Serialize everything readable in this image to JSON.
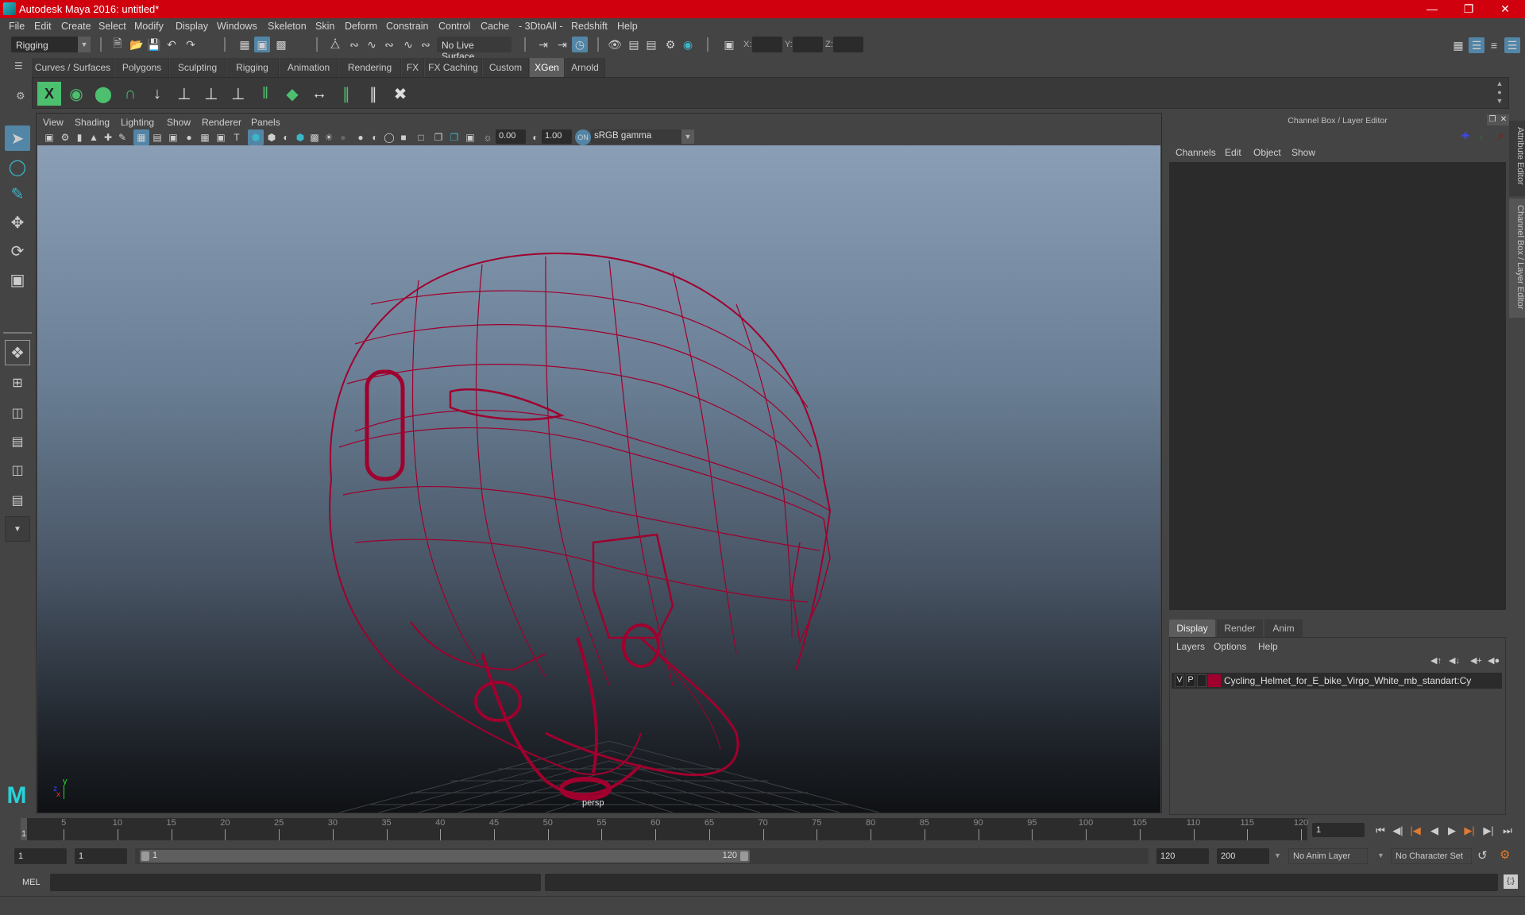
{
  "window": {
    "title": "Autodesk Maya 2016: untitled*",
    "controls": [
      "minimize",
      "restore",
      "close"
    ]
  },
  "menubar": [
    "File",
    "Edit",
    "Create",
    "Select",
    "Modify",
    "Display",
    "Windows",
    "Skeleton",
    "Skin",
    "Deform",
    "Constrain",
    "Control",
    "Cache",
    "- 3DtoAll -",
    "Redshift",
    "Help"
  ],
  "statusline": {
    "menuset": "Rigging",
    "live_surface": "No Live Surface",
    "x_label": "X:",
    "y_label": "Y:",
    "z_label": "Z:",
    "x_value": "",
    "y_value": "",
    "z_value": ""
  },
  "shelf": {
    "tabs": [
      "Curves / Surfaces",
      "Polygons",
      "Sculpting",
      "Rigging",
      "Animation",
      "Rendering",
      "FX",
      "FX Caching",
      "Custom",
      "XGen",
      "Arnold"
    ],
    "active_tab": "XGen",
    "icons": [
      "xgen-editor-icon",
      "xgen-preview-icon",
      "xgen-clear-icon",
      "add-guides-icon",
      "place-guides-icon",
      "add-guide-icon",
      "sculpt-guide-icon",
      "lock-guide-icon",
      "split-guide-icon",
      "region-map-icon",
      "rebuild-guide-icon",
      "select-guides-icon",
      "guide-width-icon",
      "delete-guide-icon"
    ]
  },
  "panel": {
    "menu": [
      "View",
      "Shading",
      "Lighting",
      "Show",
      "Renderer",
      "Panels"
    ],
    "exposure": "0.00",
    "gamma": "1.00",
    "color_space": "sRGB gamma",
    "camera_label": "persp",
    "axis": {
      "y": "y",
      "z": "z",
      "x": "x"
    },
    "wire_color": "#a0002e"
  },
  "channel_box": {
    "title": "Channel Box / Layer Editor",
    "menu": [
      "Channels",
      "Edit",
      "Object",
      "Show"
    ],
    "layer_tabs": [
      "Display",
      "Render",
      "Anim"
    ],
    "active_layer_tab": "Display",
    "layer_menu": [
      "Layers",
      "Options",
      "Help"
    ],
    "layers": [
      {
        "v": "V",
        "p": "P",
        "color": "#a0002e",
        "name": "Cycling_Helmet_for_E_bike_Virgo_White_mb_standart:Cy"
      }
    ]
  },
  "side_tabs": [
    "Attribute Editor",
    "Channel Box / Layer Editor"
  ],
  "timeline": {
    "ticks": [
      5,
      10,
      15,
      20,
      25,
      30,
      35,
      40,
      45,
      50,
      55,
      60,
      65,
      70,
      75,
      80,
      85,
      90,
      95,
      100,
      105,
      110,
      115,
      120
    ],
    "min": 1,
    "max": 120,
    "current_frame_marker": "1",
    "current_frame": "1"
  },
  "range": {
    "start": "1",
    "playback_start": "1",
    "slider_start": "1",
    "slider_end": "120",
    "playback_end": "120",
    "end": "200",
    "anim_layer": "No Anim Layer",
    "character_set": "No Character Set"
  },
  "command_line": {
    "language": "MEL",
    "input": "",
    "output": ""
  }
}
